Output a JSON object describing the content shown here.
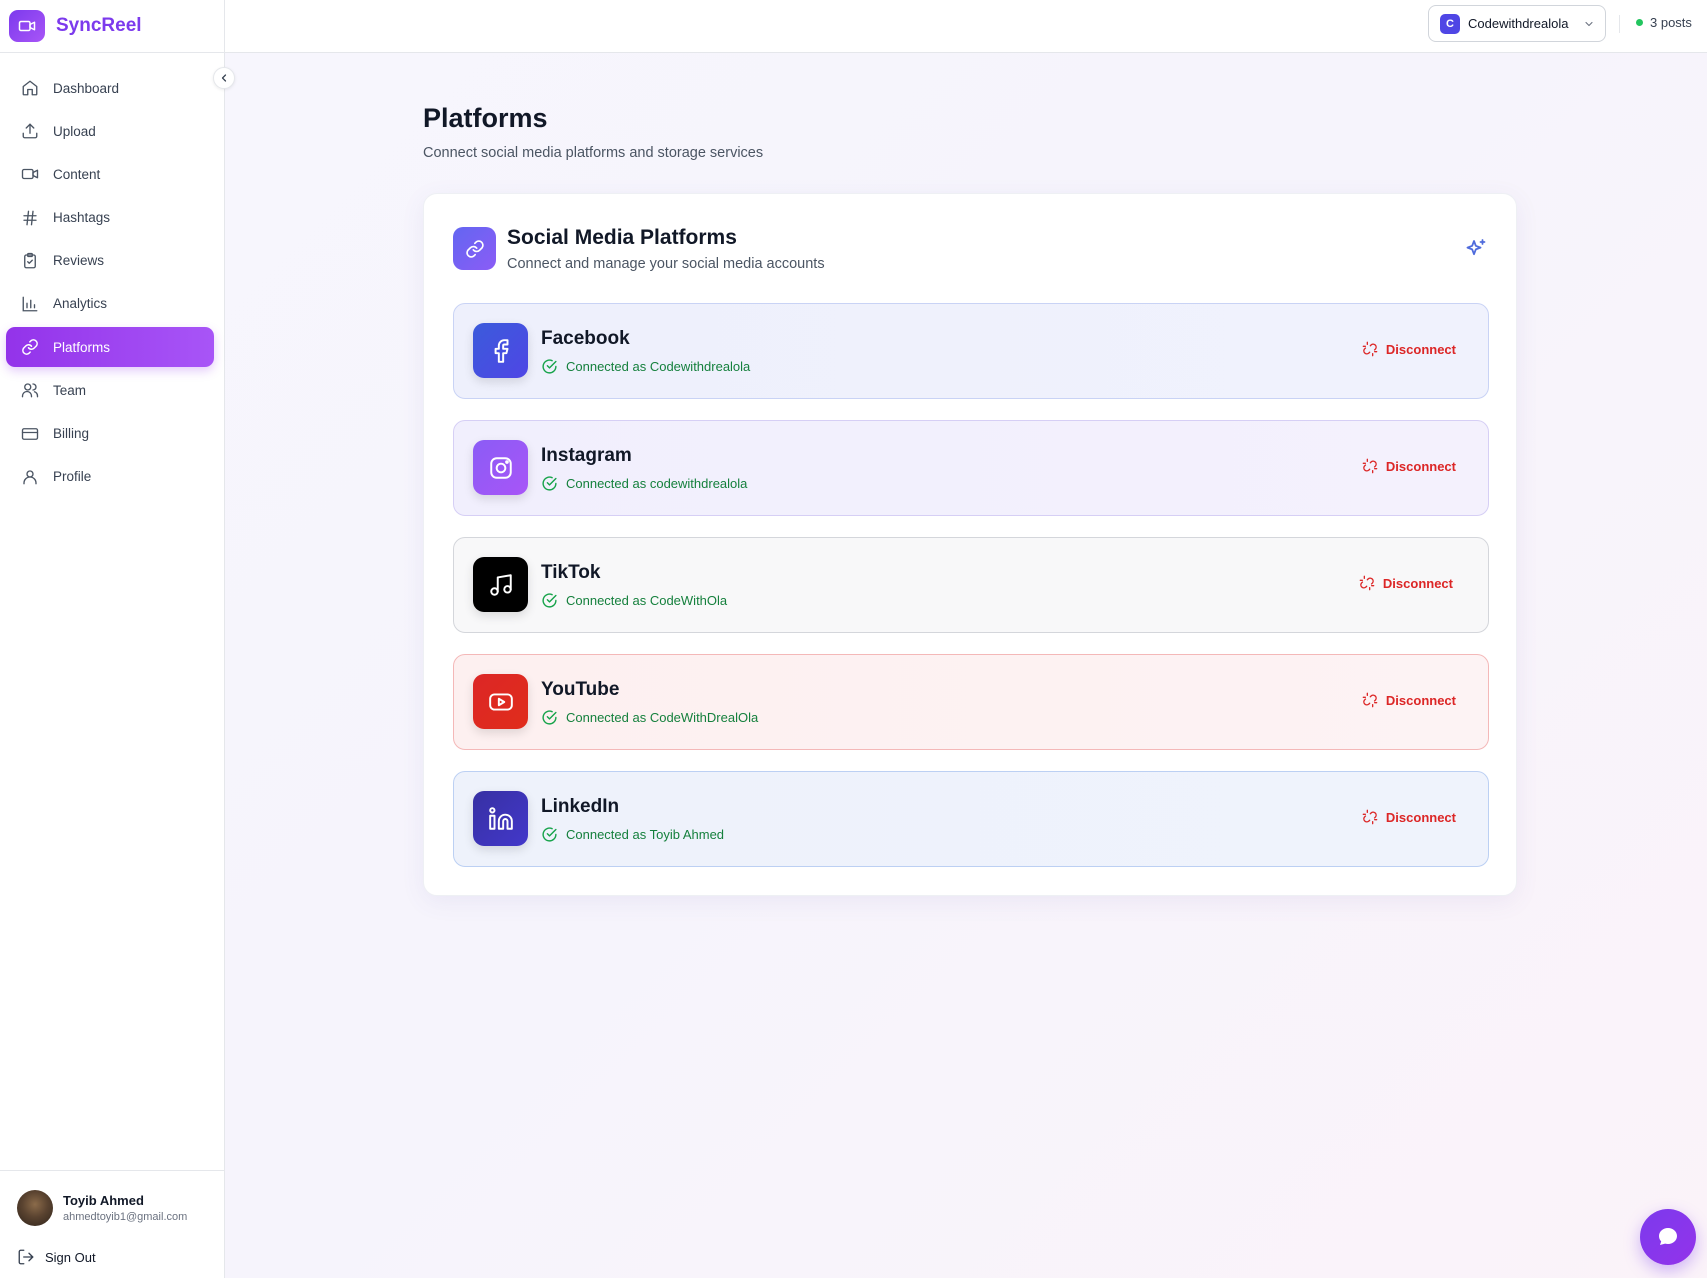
{
  "app": {
    "name": "SyncReel"
  },
  "sidebar": {
    "items": [
      {
        "label": "Dashboard",
        "icon": "home-icon"
      },
      {
        "label": "Upload",
        "icon": "upload-icon"
      },
      {
        "label": "Content",
        "icon": "video-icon"
      },
      {
        "label": "Hashtags",
        "icon": "hash-icon"
      },
      {
        "label": "Reviews",
        "icon": "clipboard-check-icon"
      },
      {
        "label": "Analytics",
        "icon": "bar-chart-icon"
      },
      {
        "label": "Platforms",
        "icon": "link-icon",
        "active": true
      },
      {
        "label": "Team",
        "icon": "users-icon"
      },
      {
        "label": "Billing",
        "icon": "credit-card-icon"
      },
      {
        "label": "Profile",
        "icon": "user-icon"
      }
    ],
    "user": {
      "name": "Toyib Ahmed",
      "email": "ahmedtoyib1@gmail.com"
    },
    "signout_label": "Sign Out"
  },
  "topbar": {
    "account": {
      "initial": "C",
      "name": "Codewithdrealola"
    },
    "posts_label": "3 posts"
  },
  "page": {
    "title": "Platforms",
    "subtitle": "Connect social media platforms and storage services"
  },
  "card": {
    "title": "Social Media Platforms",
    "subtitle": "Connect and manage your social media accounts",
    "platforms": [
      {
        "name": "Facebook",
        "status": "Connected as Codewithdrealola",
        "action": "Disconnect",
        "icon": "facebook-icon",
        "color": "#4f46e5"
      },
      {
        "name": "Instagram",
        "status": "Connected as codewithdrealola",
        "action": "Disconnect",
        "icon": "instagram-icon",
        "color": "#8b5cf6"
      },
      {
        "name": "TikTok",
        "status": "Connected as CodeWithOla",
        "action": "Disconnect",
        "icon": "music-note-icon",
        "color": "#000000"
      },
      {
        "name": "YouTube",
        "status": "Connected as CodeWithDrealOla",
        "action": "Disconnect",
        "icon": "youtube-icon",
        "color": "#dc2626"
      },
      {
        "name": "LinkedIn",
        "status": "Connected as Toyib Ahmed",
        "action": "Disconnect",
        "icon": "linkedin-icon",
        "color": "#4338ca"
      }
    ]
  },
  "colors": {
    "brand": "#7c3aed",
    "success": "#15803d",
    "danger": "#dc2626",
    "online": "#22c55e"
  }
}
